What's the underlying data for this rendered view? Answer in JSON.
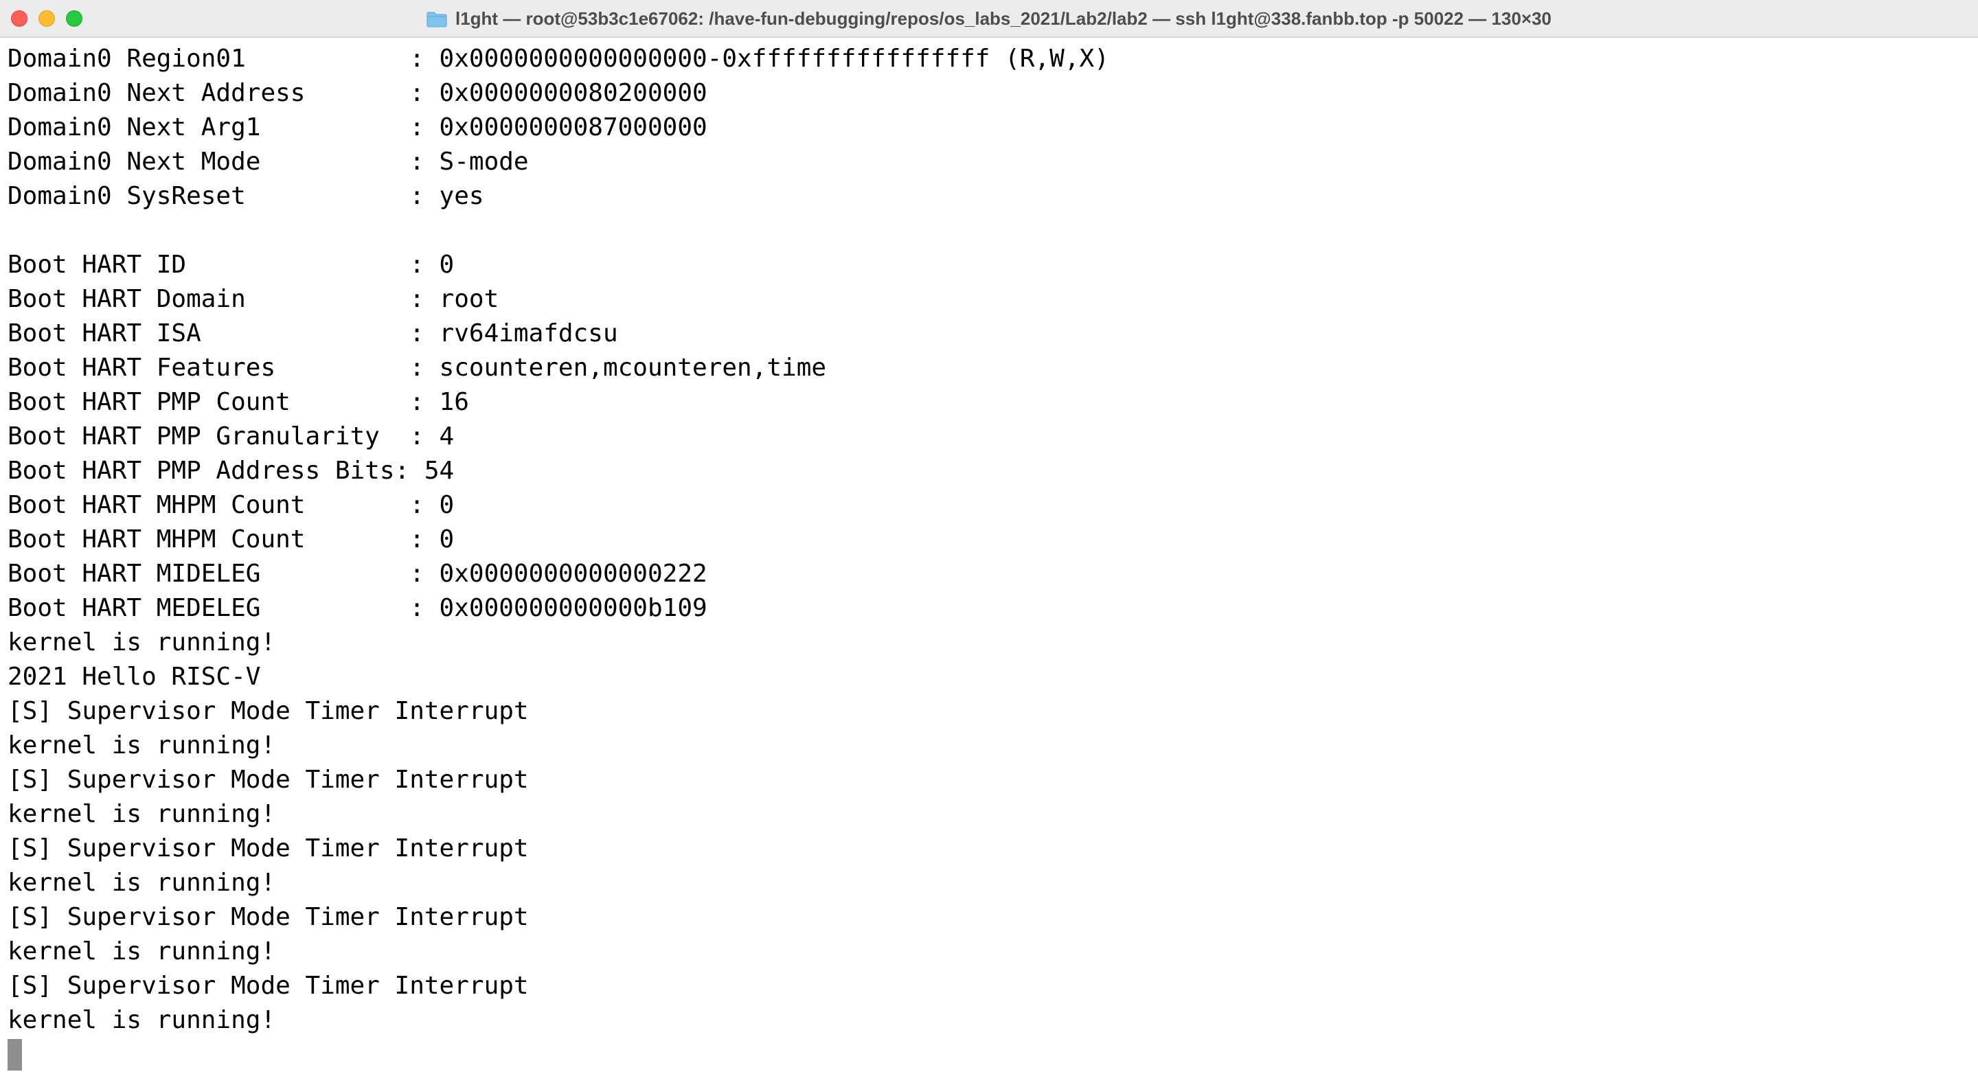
{
  "window": {
    "title": "l1ght — root@53b3c1e67062: /have-fun-debugging/repos/os_labs_2021/Lab2/lab2 — ssh l1ght@338.fanbb.top -p 50022 — 130×30",
    "icon": "folder-icon",
    "colors": {
      "close": "#fe5f57",
      "minimize": "#febc2e",
      "zoom": "#28c840",
      "titlebar": "#ececec",
      "background": "#ffffff",
      "text": "#000000",
      "cursor": "#8e8e8e"
    }
  },
  "terminal": {
    "lines": [
      "Domain0 Region01           : 0x0000000000000000-0xffffffffffffffff (R,W,X)",
      "Domain0 Next Address       : 0x0000000080200000",
      "Domain0 Next Arg1          : 0x0000000087000000",
      "Domain0 Next Mode          : S-mode",
      "Domain0 SysReset           : yes",
      "",
      "Boot HART ID               : 0",
      "Boot HART Domain           : root",
      "Boot HART ISA              : rv64imafdcsu",
      "Boot HART Features         : scounteren,mcounteren,time",
      "Boot HART PMP Count        : 16",
      "Boot HART PMP Granularity  : 4",
      "Boot HART PMP Address Bits: 54",
      "Boot HART MHPM Count       : 0",
      "Boot HART MHPM Count       : 0",
      "Boot HART MIDELEG          : 0x0000000000000222",
      "Boot HART MEDELEG          : 0x000000000000b109",
      "kernel is running!",
      "2021 Hello RISC-V",
      "[S] Supervisor Mode Timer Interrupt",
      "kernel is running!",
      "[S] Supervisor Mode Timer Interrupt",
      "kernel is running!",
      "[S] Supervisor Mode Timer Interrupt",
      "kernel is running!",
      "[S] Supervisor Mode Timer Interrupt",
      "kernel is running!",
      "[S] Supervisor Mode Timer Interrupt",
      "kernel is running!"
    ]
  }
}
